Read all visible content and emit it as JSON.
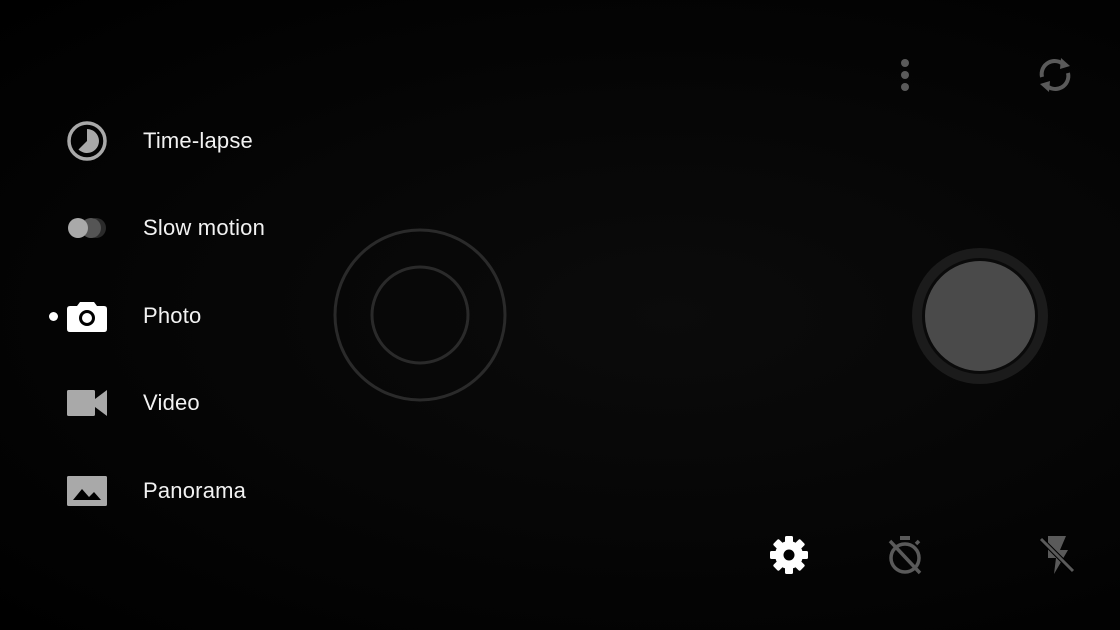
{
  "modes": [
    {
      "label": "Time-lapse",
      "icon": "timelapse-icon"
    },
    {
      "label": "Slow motion",
      "icon": "slow-motion-icon"
    },
    {
      "label": "Photo",
      "icon": "camera-icon",
      "active": true
    },
    {
      "label": "Video",
      "icon": "videocam-icon"
    },
    {
      "label": "Panorama",
      "icon": "panorama-icon"
    }
  ],
  "top_controls": {
    "more_options": "more-vert-icon",
    "switch_camera": "switch-camera-icon"
  },
  "bottom_controls": {
    "settings": "settings-icon",
    "timer": "timer-off-icon",
    "flash": "flash-off-icon"
  },
  "shutter": "shutter-button",
  "colors": {
    "background": "#000000",
    "label": "#f2f2f2",
    "icon_gray": "#a9a9a9",
    "icon_dim": "#5a5a5a",
    "shutter_inner": "#4a4a4a",
    "shutter_outer": "#1b1b1b",
    "focus_ring": "#2a2a2a"
  }
}
